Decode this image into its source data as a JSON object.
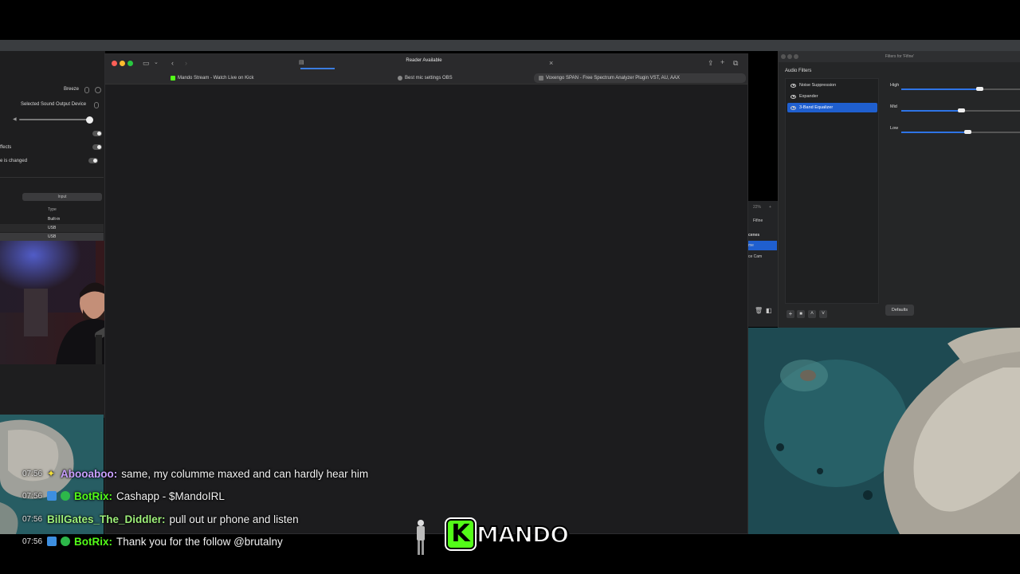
{
  "sound_panel": {
    "alert_sound_value": "Breeze",
    "output_device_value": "Selected Sound Output Device",
    "effects_label": "ffects",
    "changed_label": "e is changed",
    "input_tab_label": "Input",
    "table_type_header": "Type",
    "device_types": [
      "Built-in",
      "USB",
      "USB"
    ]
  },
  "browser": {
    "url_text": "Reader Available",
    "tabs": [
      {
        "label": "Mando Stream - Watch Live on Kick"
      },
      {
        "label": "Best mic settings OBS"
      },
      {
        "label": "Voxengo SPAN - Free Spectrum Analyzer Plugin VST, AU, AAX"
      }
    ]
  },
  "filters_window": {
    "title": "Filters for 'Fifine'",
    "heading": "Audio Filters",
    "filters": [
      {
        "label": "Noise Suppression"
      },
      {
        "label": "Expander"
      },
      {
        "label": "3-Band Equalizer"
      }
    ],
    "eq": [
      {
        "label": "High",
        "level": 0.65
      },
      {
        "label": "Mid",
        "level": 0.5
      },
      {
        "label": "Low",
        "level": 0.55
      }
    ],
    "defaults_label": "Defaults"
  },
  "obs": {
    "zoom_text": "22%",
    "source_name": "Fifine",
    "scenes_label": "cenes",
    "scene_items": [
      "me",
      "ce Cam"
    ]
  },
  "chat": {
    "lines": [
      {
        "time": "07:56",
        "user": "Abooaboo:",
        "message": "same, my columme maxed and can hardly hear him",
        "color": "#c9a0ff"
      },
      {
        "time": "07:56",
        "user": "BotRix:",
        "message": "Cashapp - $MandoIRL",
        "color": "#53fc18"
      },
      {
        "time": "07:56",
        "user": "BillGates_The_Diddler:",
        "message": "pull out ur phone and listen",
        "color": "#9ef07a"
      },
      {
        "time": "07:56",
        "user": "BotRix:",
        "message": "Thank you for the follow @brutalny",
        "color": "#53fc18"
      }
    ]
  },
  "overlay": {
    "logo_letter": "K",
    "logo_text": "MANDO"
  },
  "colors": {
    "kick_green": "#53fc18",
    "accent_blue": "#1f5fcf"
  }
}
